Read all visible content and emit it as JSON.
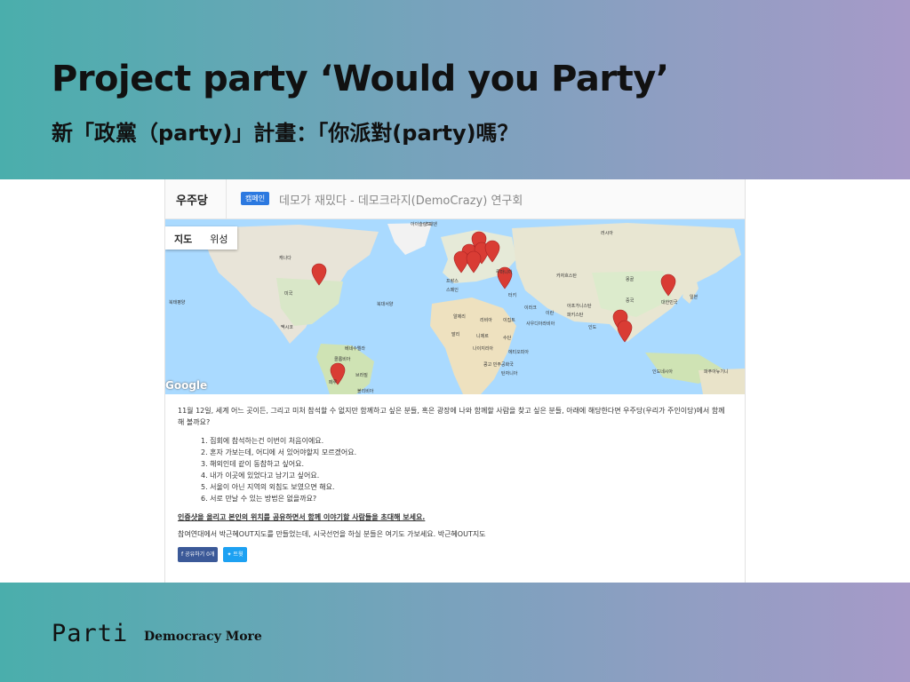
{
  "slide": {
    "title": "Project party ‘Would you Party’",
    "subtitle": "新「政黨（party)」計畫：「你派對(party)嗎？",
    "logo": "Parti",
    "tagline": "Democracy More"
  },
  "screenshot": {
    "brand": "우주당",
    "badge": "캠페인",
    "header_title": "데모가 재밌다 - 데모크라지(DemoCrazy) 연구회",
    "map": {
      "toggle": [
        "지도",
        "위성"
      ],
      "google": "Google",
      "labels": [
        "스웨덴",
        "러시아",
        "아이슬란드",
        "캐나다",
        "미국",
        "멕시코",
        "북대서양",
        "북태평양",
        "프랑스",
        "스페인",
        "루마니아",
        "카자흐스탄",
        "몽골",
        "중국",
        "대한민국",
        "일본",
        "터키",
        "이라크",
        "이란",
        "아프가니스탄",
        "파키스탄",
        "인도",
        "알제리",
        "리비아",
        "이집트",
        "사우디아라비아",
        "말리",
        "니제르",
        "수단",
        "나이지리아",
        "에티오피아",
        "콩고 민주공화국",
        "탄자니아",
        "베네수엘라",
        "콜롬비아",
        "페루",
        "브라질",
        "볼리비아",
        "인도네시아",
        "파푸아뉴기니"
      ]
    },
    "intro": "11월 12일, 세계 어느 곳이든, 그리고 미처 참석할 수 없지만 함께하고 싶은 분들, 혹은 광장에 나와 함께할 사람을 찾고 싶은 분들, 아래에 해당한다면 우주당(우리가 주인이당)에서 함께 해 볼까요?",
    "list": [
      "1. 집회에 참석하는건 이번이 처음이에요.",
      "2. 혼자 가보는데, 어디에 서 있어야할지 모르겠어요.",
      "3. 해외인데 같이 동참하고 싶어요.",
      "4. 내가 이곳에 있었다고 남기고 싶어요.",
      "5. 서울이 아닌 지역의 외침도 보였으면 해요.",
      "6. 서로 만날 수 있는 방법은 없을까요?"
    ],
    "invite": "인증샷을 올리고 본인의 위치를 공유하면서 함께 이야기할 사람들을 초대해 보세요.",
    "note": "참여연대에서 박근혜OUT지도를 만들었는데, 시국선언을 하실 분들은 여기도 가보세요. 박근혜OUT지도",
    "share": {
      "facebook": "공유하기 0개",
      "twitter": "트윗"
    }
  }
}
